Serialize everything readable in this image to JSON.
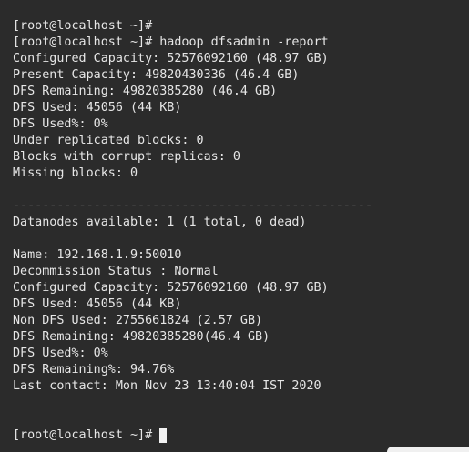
{
  "terminal": {
    "lines": [
      "[root@localhost ~]#",
      "[root@localhost ~]# hadoop dfsadmin -report",
      "Configured Capacity: 52576092160 (48.97 GB)",
      "Present Capacity: 49820430336 (46.4 GB)",
      "DFS Remaining: 49820385280 (46.4 GB)",
      "DFS Used: 45056 (44 KB)",
      "DFS Used%: 0%",
      "Under replicated blocks: 0",
      "Blocks with corrupt replicas: 0",
      "Missing blocks: 0",
      "",
      "-------------------------------------------------",
      "Datanodes available: 1 (1 total, 0 dead)",
      "",
      "Name: 192.168.1.9:50010",
      "Decommission Status : Normal",
      "Configured Capacity: 52576092160 (48.97 GB)",
      "DFS Used: 45056 (44 KB)",
      "Non DFS Used: 2755661824 (2.57 GB)",
      "DFS Remaining: 49820385280(46.4 GB)",
      "DFS Used%: 0%",
      "DFS Remaining%: 94.76%",
      "Last contact: Mon Nov 23 13:40:04 IST 2020",
      "",
      "",
      "[root@localhost ~]#"
    ]
  }
}
